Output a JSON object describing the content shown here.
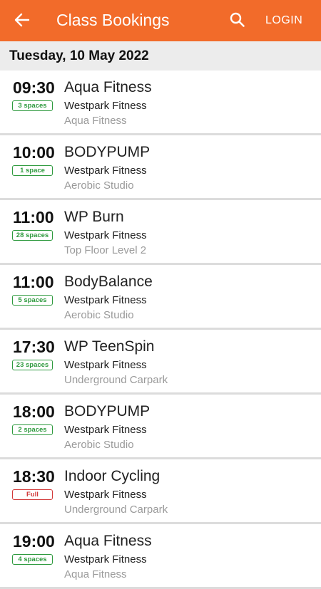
{
  "header": {
    "title": "Class Bookings",
    "login_label": "LOGIN",
    "back_icon": "arrow-left-icon",
    "search_icon": "search-icon",
    "background_color": "#f26b2a"
  },
  "date_header": "Tuesday, 10 May 2022",
  "classes": [
    {
      "time": "09:30",
      "spaces": "3 spaces",
      "full": false,
      "name": "Aqua Fitness",
      "venue": "Westpark Fitness",
      "room": "Aqua Fitness"
    },
    {
      "time": "10:00",
      "spaces": "1 space",
      "full": false,
      "name": "BODYPUMP",
      "venue": "Westpark Fitness",
      "room": "Aerobic Studio"
    },
    {
      "time": "11:00",
      "spaces": "28 spaces",
      "full": false,
      "name": "WP Burn",
      "venue": "Westpark Fitness",
      "room": "Top Floor Level 2"
    },
    {
      "time": "11:00",
      "spaces": "5 spaces",
      "full": false,
      "name": "BodyBalance",
      "venue": "Westpark Fitness",
      "room": "Aerobic Studio"
    },
    {
      "time": "17:30",
      "spaces": "23 spaces",
      "full": false,
      "name": "WP TeenSpin",
      "venue": "Westpark Fitness",
      "room": "Underground Carpark"
    },
    {
      "time": "18:00",
      "spaces": "2 spaces",
      "full": false,
      "name": "BODYPUMP",
      "venue": "Westpark Fitness",
      "room": "Aerobic Studio"
    },
    {
      "time": "18:30",
      "spaces": "Full",
      "full": true,
      "name": "Indoor Cycling",
      "venue": "Westpark Fitness",
      "room": "Underground Carpark"
    },
    {
      "time": "19:00",
      "spaces": "4 spaces",
      "full": false,
      "name": "Aqua Fitness",
      "venue": "Westpark Fitness",
      "room": "Aqua Fitness"
    }
  ]
}
